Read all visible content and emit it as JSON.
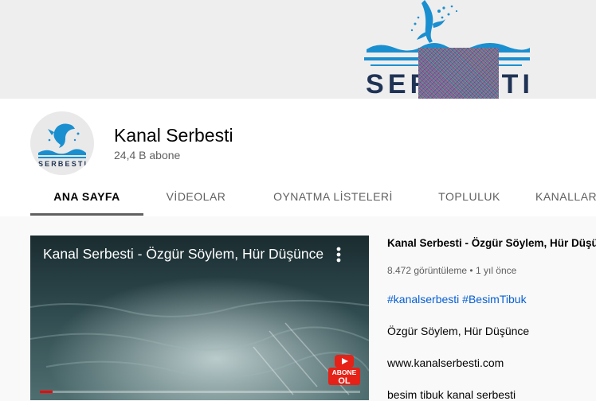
{
  "banner": {
    "logo_text": "SERBESTI"
  },
  "channel": {
    "name": "Kanal Serbesti",
    "subscribers": "24,4 B abone",
    "avatar_text": "SERBESTI"
  },
  "tabs": [
    {
      "label": "ANA SAYFA",
      "active": true
    },
    {
      "label": "VİDEOLAR",
      "active": false
    },
    {
      "label": "OYNATMA LİSTELERİ",
      "active": false
    },
    {
      "label": "TOPLULUK",
      "active": false
    },
    {
      "label": "KANALLAR",
      "active": false
    }
  ],
  "featured_video": {
    "title": "Kanal Serbesti - Özgür Söylem, Hür Düşünce",
    "badge": {
      "line1": "ABONE",
      "line2": "OL"
    },
    "progress": 0.04,
    "colors": {
      "progress": "#ff0000",
      "badge": "#e62117"
    }
  },
  "description": {
    "title": "Kanal Serbesti - Özgür Söylem, Hür Düşünce",
    "meta": "8.472 görüntüleme • 1 yıl önce",
    "hashtags": "#kanalserbesti #BesimTibuk",
    "lines": [
      "Özgür Söylem, Hür Düşünce",
      "www.kanalserbesti.com",
      "besim tibuk kanal serbesti"
    ]
  },
  "colors": {
    "link": "#065fd4",
    "brand_blue": "#1a8fd0",
    "logo_navy": "#1f3355"
  }
}
